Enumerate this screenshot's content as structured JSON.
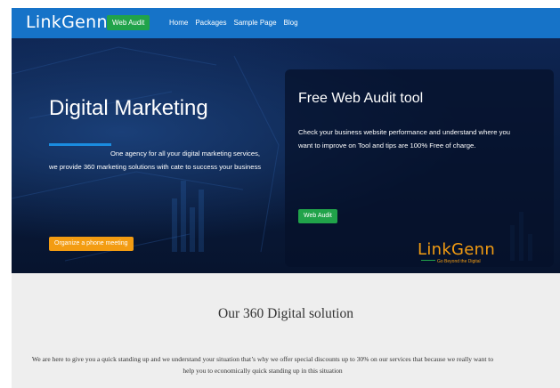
{
  "navbar": {
    "logo": "LinkGenn",
    "audit_button": "Web Audit",
    "links": [
      "Home",
      "Packages",
      "Sample Page",
      "Blog"
    ]
  },
  "hero": {
    "title": "Digital Marketing",
    "description": "One agency for all your digital marketing services, we provide 360 marketing solutions with cate to success your business",
    "cta_button": "Organize a phone meeting",
    "audit_card": {
      "title": "Free Web Audit tool",
      "description": "Check your business website performance and understand where you want to improve on Tool and tips are 100% Free of charge.",
      "button": "Web Audit",
      "brand_name": "LinkGenn",
      "brand_tagline": "Go Beyond the Digital"
    }
  },
  "solution": {
    "title": "Our 360 Digital solution",
    "description": "We are here to give you a quick standing up and we understand your situation that’s why we offer special discounts up to 30% on our services that because we really want to help you to economically quick standing up in this situation"
  },
  "colors": {
    "navbar": "#1673c8",
    "green_button": "#21a34a",
    "orange_button": "#f39c12",
    "hero_bg": "#0e2552",
    "section_bg": "#eeeeee"
  }
}
